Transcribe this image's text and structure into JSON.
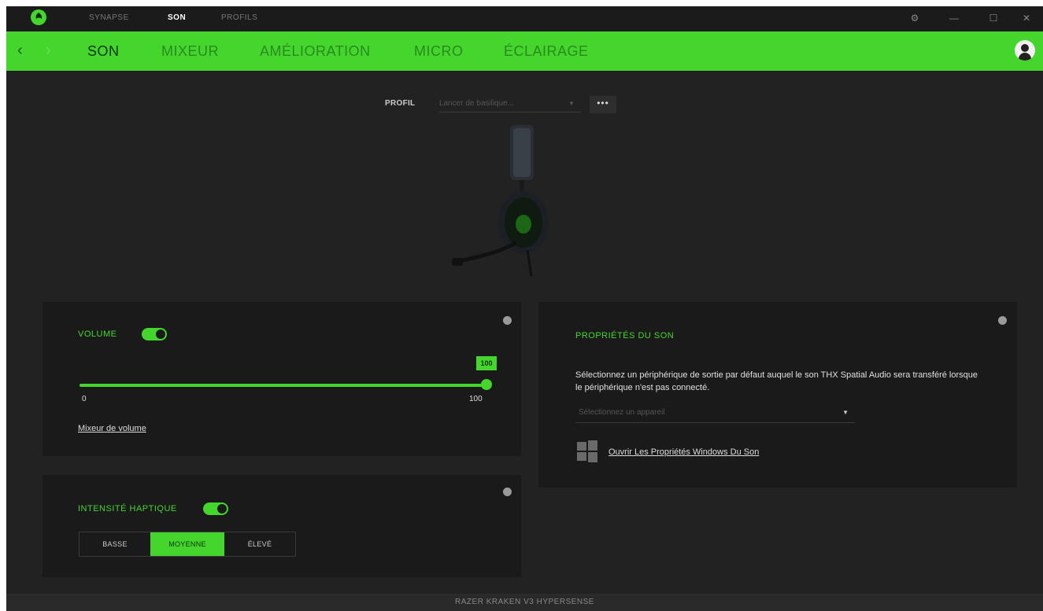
{
  "titlebar": {
    "tabs": [
      "SYNAPSE",
      "SON",
      "PROFILS"
    ],
    "active_tab": "SON",
    "controls": [
      "settings-icon",
      "minimize-icon",
      "maximize-icon",
      "close-icon"
    ]
  },
  "navbar": {
    "tabs": [
      "SON",
      "MIXEUR",
      "AMÉLIORATION",
      "MICRO",
      "ÉCLAIRAGE"
    ],
    "active_tab": "SON",
    "accent": "#44d62c"
  },
  "profile": {
    "label": "PROFIL",
    "selected": "Lancer de basilique...",
    "more_label": "•••"
  },
  "volume": {
    "label": "VOLUME",
    "enabled": true,
    "value": "100",
    "min": "0",
    "max": "100",
    "mixer_link": "Mixeur de volume"
  },
  "haptic": {
    "label": "INTENSITÉ HAPTIQUE",
    "enabled": true,
    "options": [
      "BASSE",
      "MOYENNE",
      "ÉLEVÉ"
    ],
    "selected": "MOYENNE"
  },
  "sound_properties": {
    "title": "PROPRIÉTÉS DU SON",
    "description": "Sélectionnez un périphérique de sortie par défaut auquel le son THX Spatial Audio sera transféré lorsque le périphérique n'est pas connecté.",
    "device_placeholder": "Sélectionnez un appareil",
    "windows_link": "Ouvrir Les Propriétés Windows Du Son"
  },
  "footer": {
    "device_name": "RAZER KRAKEN V3 HYPERSENSE"
  }
}
